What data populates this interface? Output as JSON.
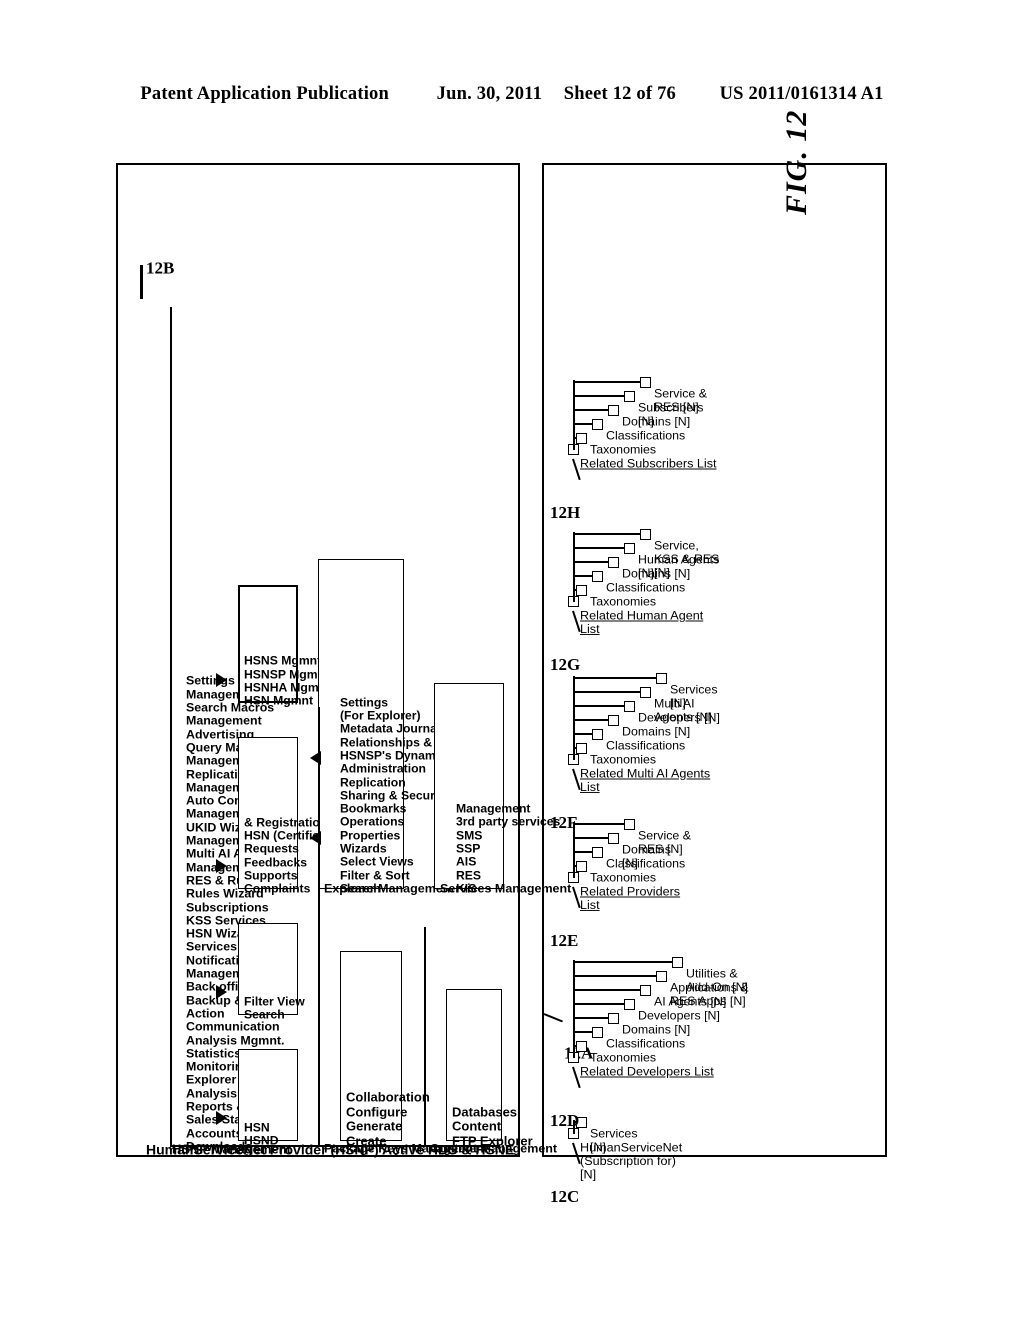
{
  "page_header": {
    "publication": "Patent Application Publication",
    "date": "Jun. 30, 2011",
    "sheet": "Sheet 12 of 76",
    "patent_number": "US 2011/0161314 A1"
  },
  "figure": {
    "label": "FIG. 12",
    "main_title": "HumanServiceNet Provider (HSNP) Active HDS & HSNE",
    "ref_12A": "12A",
    "ref_12B": "12B",
    "ref_12C": "12C",
    "ref_12D": "12D",
    "ref_12E": "12E",
    "ref_12F": "12F",
    "ref_12G": "12G",
    "ref_12H": "12H"
  },
  "hsnp_management": {
    "title": "HSNP Management",
    "items": [
      "Downloads",
      "Accounts &",
      "Sales Status",
      "Reports &",
      "Analysis",
      "Explorer",
      "Monitoring",
      "Statistics &",
      "Analysis Mgmnt.",
      "Communication",
      "Action",
      "Backup & Restore",
      "Back office",
      "Management",
      "Notification",
      "Services",
      "HSN Wizards",
      "KSS Services",
      "Subscriptions",
      "Rules Wizard",
      "RES & Rules",
      "Management",
      "Multi AI Agents",
      "Management",
      "UKID Wizards &",
      "Management",
      "Auto Content",
      "Management",
      "Replication",
      "Management",
      "Query Manager",
      "Advertising",
      "Management",
      "Search Macros",
      "Management",
      "Settings"
    ]
  },
  "top_boxes": {
    "package_keys_management": {
      "title": "Package Keys Management",
      "items": [
        "Create",
        "Generate",
        "Configure",
        "Collaboration"
      ]
    },
    "content_management": {
      "title": "Content Management",
      "items": [
        "FTP Explorer",
        "Content",
        "Databases"
      ]
    }
  },
  "mid_boxes": {
    "explorer_management": {
      "title": "Explorer Management",
      "items": [
        "Search",
        "Filter & Sort",
        "Select Views",
        "Wizards",
        "Properties",
        "Operations",
        "Bookmarks",
        "Sharing & Security",
        "Replication",
        "Administration",
        "HSNSP's Dynamic",
        "Relationships &",
        "Metadata Journal",
        "(For Explorer)",
        "Settings"
      ]
    },
    "services_management": {
      "title": "Services Management",
      "items": [
        "KIS",
        "RES",
        "AIS",
        "SSP",
        "SMS",
        "3rd party services",
        "Management"
      ]
    }
  },
  "small_boxes": [
    {
      "name": "hsnd-hsn-box",
      "items": [
        "HSND",
        "HSN"
      ]
    },
    {
      "name": "search-filter-box",
      "items": [
        "Search",
        "Filter View"
      ]
    },
    {
      "name": "complaints-box",
      "items": [
        "Complaints",
        "Supports",
        "Feedbacks",
        "Requests",
        "HSN (Certification",
        "& Registration)"
      ]
    },
    {
      "name": "hsn-mgmnt-box",
      "items": [
        "HSN Mgmnt",
        "HSNHA Mgmnt",
        "HSNSP Mgmnt",
        "HSNS Mgmnt"
      ]
    }
  ],
  "trees": [
    {
      "ref": "12C",
      "root": "HumanServiceNet (Subscription for) [N]",
      "children": [
        "Services [N]"
      ]
    },
    {
      "ref": "12D",
      "root": "Related Developers List",
      "children": [
        "Taxonomies",
        "Classifications",
        "Domains [N]",
        "Developers [N]",
        "AI Agents [N]",
        "Applications & RES Apps [N]",
        "Utilities & Add-On [N]"
      ]
    },
    {
      "ref": "12E",
      "root": "Related Providers List",
      "children": [
        "Taxonomies",
        "Classifications",
        "Domains [N]",
        "Service & RES [N]"
      ]
    },
    {
      "ref": "12F",
      "root": "Related Multi AI Agents List",
      "children": [
        "Taxonomies",
        "Classifications",
        "Domains [N]",
        "Developers [N]",
        "Multi AI Agents [N]",
        "Services [N]"
      ]
    },
    {
      "ref": "12G",
      "root": "Related Human Agent List",
      "children": [
        "Taxonomies",
        "Classifications",
        "Domains [N]",
        "Human Agents [N]",
        "Service, KSS & RES [N]"
      ]
    },
    {
      "ref": "12H",
      "root": "Related Subscribers List",
      "children": [
        "Taxonomies",
        "Classifications",
        "Domains [N]",
        "Subscribers [N]",
        "Service & RES [N]"
      ]
    }
  ]
}
